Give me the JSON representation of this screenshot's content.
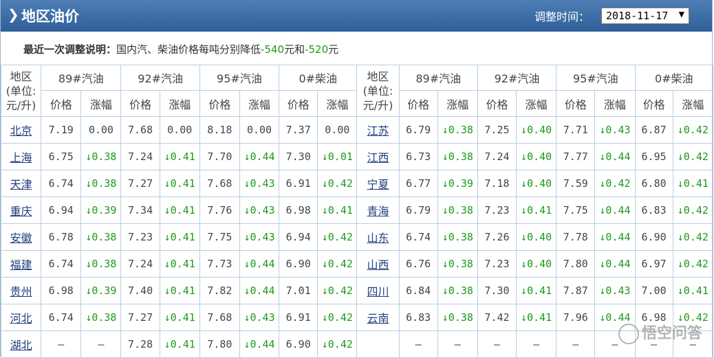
{
  "header": {
    "title": "地区油价",
    "chevron_icon": "chevron-right-icon",
    "adjust_time_label": "调整时间：",
    "adjust_date": "2018-11-17",
    "dropdown_icon": "▼"
  },
  "notice": {
    "label": "最近一次调整说明：",
    "text_prefix": "国内汽、柴油价格每吨分别降低",
    "gasoline_change": "-540",
    "unit1": "元和",
    "diesel_change": "-520",
    "unit2": "元"
  },
  "table": {
    "region_header": "地区\n(单位:\n元/升)",
    "fuels": [
      "89#汽油",
      "92#汽油",
      "95#汽油",
      "0#柴油"
    ],
    "price_label": "价格",
    "change_label": "涨幅",
    "left_rows": [
      {
        "region": "北京",
        "vals": [
          "7.19",
          "0.00",
          "7.68",
          "0.00",
          "8.18",
          "0.00",
          "7.37",
          "0.00"
        ]
      },
      {
        "region": "上海",
        "vals": [
          "6.75",
          "↓0.38",
          "7.24",
          "↓0.41",
          "7.70",
          "↓0.44",
          "7.30",
          "↓0.01"
        ]
      },
      {
        "region": "天津",
        "vals": [
          "6.74",
          "↓0.38",
          "7.27",
          "↓0.41",
          "7.68",
          "↓0.43",
          "6.91",
          "↓0.42"
        ]
      },
      {
        "region": "重庆",
        "vals": [
          "6.94",
          "↓0.39",
          "7.34",
          "↓0.41",
          "7.76",
          "↓0.43",
          "6.98",
          "↓0.41"
        ]
      },
      {
        "region": "安徽",
        "vals": [
          "6.78",
          "↓0.38",
          "7.23",
          "↓0.41",
          "7.75",
          "↓0.43",
          "6.94",
          "↓0.42"
        ]
      },
      {
        "region": "福建",
        "vals": [
          "6.74",
          "↓0.38",
          "7.24",
          "↓0.41",
          "7.73",
          "↓0.44",
          "6.90",
          "↓0.42"
        ]
      },
      {
        "region": "贵州",
        "vals": [
          "6.98",
          "↓0.39",
          "7.40",
          "↓0.41",
          "7.82",
          "↓0.44",
          "7.01",
          "↓0.42"
        ]
      },
      {
        "region": "河北",
        "vals": [
          "6.74",
          "↓0.38",
          "7.27",
          "↓0.41",
          "7.68",
          "↓0.43",
          "6.91",
          "↓0.42"
        ]
      },
      {
        "region": "湖北",
        "vals": [
          "–",
          "–",
          "7.28",
          "↓0.41",
          "7.80",
          "↓0.44",
          "6.90",
          "↓0.42"
        ]
      }
    ],
    "right_rows": [
      {
        "region": "江苏",
        "vals": [
          "6.79",
          "↓0.38",
          "7.25",
          "↓0.40",
          "7.71",
          "↓0.43",
          "6.87",
          "↓0.42"
        ]
      },
      {
        "region": "江西",
        "vals": [
          "6.73",
          "↓0.38",
          "7.24",
          "↓0.40",
          "7.77",
          "↓0.44",
          "6.95",
          "↓0.42"
        ]
      },
      {
        "region": "宁夏",
        "vals": [
          "6.77",
          "↓0.39",
          "7.18",
          "↓0.40",
          "7.59",
          "↓0.42",
          "6.80",
          "↓0.41"
        ]
      },
      {
        "region": "青海",
        "vals": [
          "6.79",
          "↓0.38",
          "7.23",
          "↓0.41",
          "7.75",
          "↓0.44",
          "6.83",
          "↓0.42"
        ]
      },
      {
        "region": "山东",
        "vals": [
          "6.74",
          "↓0.38",
          "7.26",
          "↓0.40",
          "7.78",
          "↓0.44",
          "6.90",
          "↓0.42"
        ]
      },
      {
        "region": "山西",
        "vals": [
          "6.76",
          "↓0.38",
          "7.23",
          "↓0.40",
          "7.80",
          "↓0.44",
          "6.97",
          "↓0.42"
        ]
      },
      {
        "region": "四川",
        "vals": [
          "6.84",
          "↓0.38",
          "7.30",
          "↓0.41",
          "7.87",
          "↓0.43",
          "7.00",
          "↓0.41"
        ]
      },
      {
        "region": "云南",
        "vals": [
          "6.83",
          "↓0.38",
          "7.42",
          "↓0.41",
          "7.96",
          "↓0.44",
          "6.98",
          "↓0.42"
        ]
      },
      {
        "region": "",
        "vals": [
          "–",
          "–",
          "–",
          "–",
          "–",
          "–",
          "–",
          "–"
        ]
      }
    ]
  },
  "watermark": {
    "text": "悟空问答",
    "icon": "wukong-logo-icon"
  }
}
